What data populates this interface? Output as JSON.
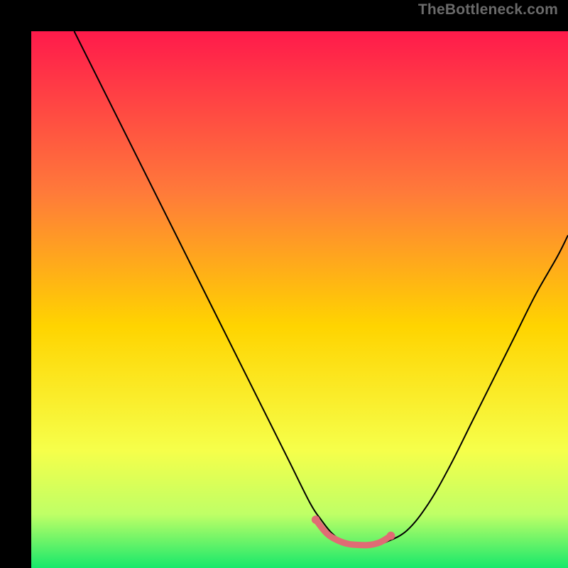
{
  "watermark": "TheBottleneck.com",
  "chart_data": {
    "type": "line",
    "title": "",
    "xlabel": "",
    "ylabel": "",
    "xlim": [
      0,
      100
    ],
    "ylim": [
      0,
      100
    ],
    "grid": false,
    "legend": false,
    "gradient_stops": [
      {
        "offset": 0.0,
        "color": "#ff1a4b"
      },
      {
        "offset": 0.3,
        "color": "#ff7a3a"
      },
      {
        "offset": 0.55,
        "color": "#ffd400"
      },
      {
        "offset": 0.78,
        "color": "#f6ff4a"
      },
      {
        "offset": 0.9,
        "color": "#bfff66"
      },
      {
        "offset": 1.0,
        "color": "#17e86b"
      }
    ],
    "series": [
      {
        "name": "bottleneck-curve",
        "color": "#000000",
        "width": 2,
        "x": [
          8,
          12,
          16,
          20,
          24,
          28,
          32,
          36,
          40,
          44,
          48,
          52,
          54,
          56,
          58,
          60,
          62,
          64,
          66,
          70,
          74,
          78,
          82,
          86,
          90,
          94,
          98,
          100
        ],
        "y": [
          100,
          92,
          84,
          76,
          68,
          60,
          52,
          44,
          36,
          28,
          20,
          12,
          9,
          6.5,
          5,
          4.4,
          4.2,
          4.3,
          4.8,
          7,
          12,
          19,
          27,
          35,
          43,
          51,
          58,
          62
        ]
      },
      {
        "name": "bottom-marker",
        "color": "#e06b74",
        "width": 9,
        "caps": "round",
        "x": [
          53,
          55,
          57,
          59,
          61,
          63,
          65,
          67
        ],
        "y": [
          9,
          6.5,
          5.2,
          4.5,
          4.3,
          4.3,
          4.8,
          6
        ]
      }
    ]
  }
}
